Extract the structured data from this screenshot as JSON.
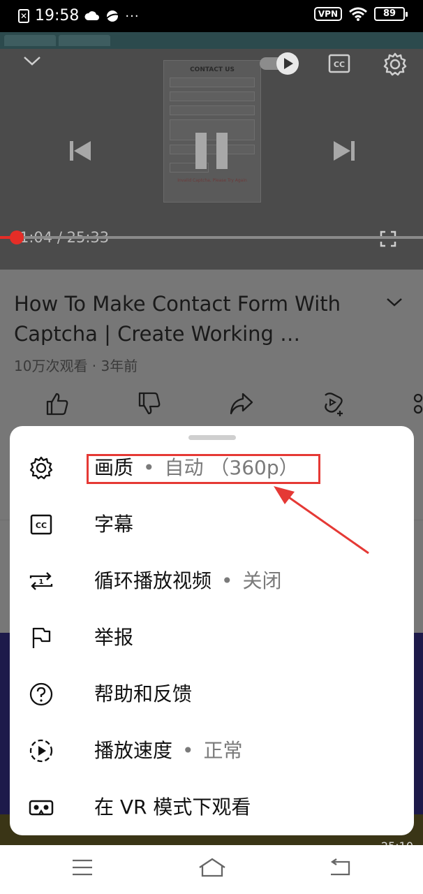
{
  "status_bar": {
    "time": "19:58",
    "dots": "···",
    "vpn": "VPN",
    "battery": "89"
  },
  "player": {
    "video_frame": {
      "title": "CONTACT US",
      "error": "Invalid Captcha, Please Try Again"
    },
    "current_time": "1:04",
    "separator": " / ",
    "duration": "25:33",
    "progress_fraction": 0.042
  },
  "video": {
    "title": "How To Make Contact Form With Captcha | Create Working …",
    "views": "10万次观看",
    "meta_separator": " · ",
    "age": "3年前",
    "next_duration": "25:10"
  },
  "menu": {
    "items": [
      {
        "icon": "gear-icon",
        "label": "画质",
        "value": "自动 （360p）"
      },
      {
        "icon": "captions-icon",
        "label": "字幕",
        "value": ""
      },
      {
        "icon": "loop-icon",
        "label": "循环播放视频",
        "value": "关闭"
      },
      {
        "icon": "flag-icon",
        "label": "举报",
        "value": ""
      },
      {
        "icon": "help-icon",
        "label": "帮助和反馈",
        "value": ""
      },
      {
        "icon": "playback-speed-icon",
        "label": "播放速度",
        "value": "正常"
      },
      {
        "icon": "vr-headset-icon",
        "label": "在 VR 模式下观看",
        "value": ""
      }
    ],
    "bullet": "•"
  },
  "colors": {
    "accent_red": "#e52d27",
    "highlight_red": "#e53935"
  }
}
